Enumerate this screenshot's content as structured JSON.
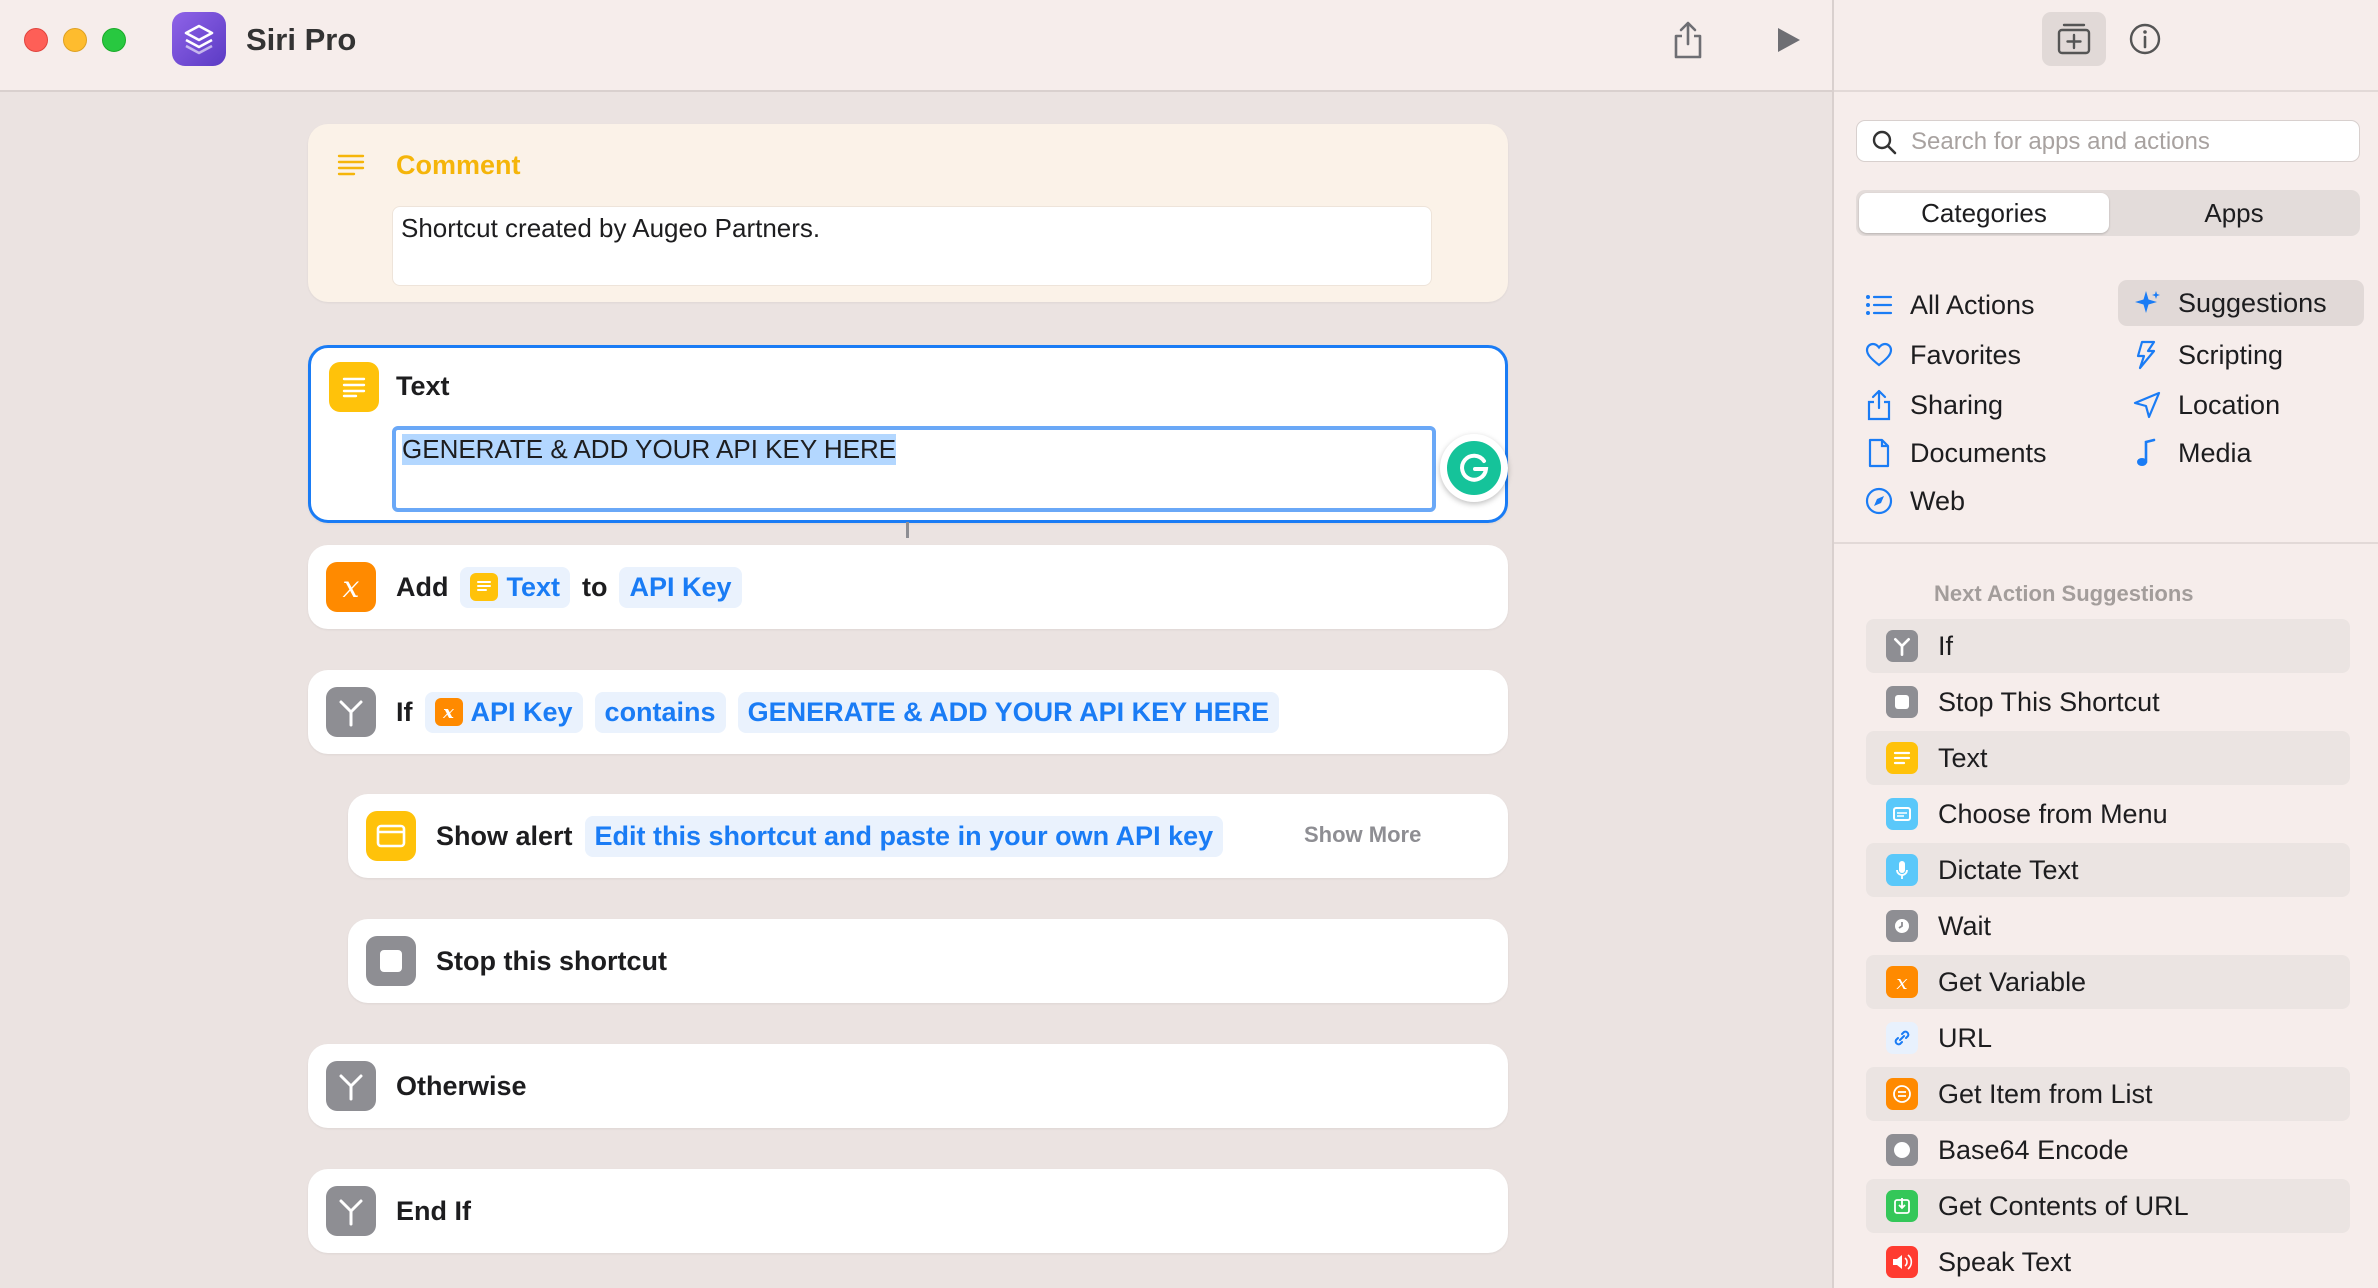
{
  "window": {
    "title": "Siri Pro"
  },
  "toolbar": {
    "share_icon": "share-icon",
    "run_icon": "play-icon"
  },
  "sidebar_toolbar": {
    "library_icon": "action-library-icon",
    "info_icon": "info-icon"
  },
  "editor": {
    "comment": {
      "label": "Comment",
      "body": "Shortcut created by Augeo Partners."
    },
    "text_action": {
      "label": "Text",
      "value": "GENERATE & ADD YOUR API KEY HERE"
    },
    "add_action": {
      "label": "Add",
      "input": "Text",
      "connector": "to",
      "variable": "API Key"
    },
    "if_action": {
      "label": "If",
      "variable": "API Key",
      "operator": "contains",
      "value": "GENERATE & ADD YOUR API KEY HERE"
    },
    "alert_action": {
      "label": "Show alert",
      "message": "Edit this shortcut and paste in your own API key",
      "show_more": "Show More"
    },
    "stop_action": {
      "label": "Stop this shortcut"
    },
    "otherwise_action": {
      "label": "Otherwise"
    },
    "endif_action": {
      "label": "End If"
    }
  },
  "sidebar": {
    "search_placeholder": "Search for apps and actions",
    "segments": [
      "Categories",
      "Apps"
    ],
    "categories": [
      {
        "label": "All Actions",
        "icon": "list-icon"
      },
      {
        "label": "Suggestions",
        "icon": "sparkle-icon",
        "selected": true
      },
      {
        "label": "Favorites",
        "icon": "heart-icon"
      },
      {
        "label": "Scripting",
        "icon": "scripting-icon"
      },
      {
        "label": "Sharing",
        "icon": "share-icon"
      },
      {
        "label": "Location",
        "icon": "location-arrow-icon"
      },
      {
        "label": "Documents",
        "icon": "document-icon"
      },
      {
        "label": "Media",
        "icon": "music-note-icon"
      },
      {
        "label": "Web",
        "icon": "compass-icon"
      }
    ],
    "next_title": "Next Action Suggestions",
    "suggestions": [
      {
        "label": "If",
        "color": "#8e8e93"
      },
      {
        "label": "Stop This Shortcut",
        "color": "#8e8e93"
      },
      {
        "label": "Text",
        "color": "#ffc20a"
      },
      {
        "label": "Choose from Menu",
        "color": "#5ac8fa"
      },
      {
        "label": "Dictate Text",
        "color": "#5ac8fa"
      },
      {
        "label": "Wait",
        "color": "#8e8e93"
      },
      {
        "label": "Get Variable",
        "color": "#ff8a00"
      },
      {
        "label": "URL",
        "color": "#1a7cf5"
      },
      {
        "label": "Get Item from List",
        "color": "#ff8a00"
      },
      {
        "label": "Base64 Encode",
        "color": "#8e8e93"
      },
      {
        "label": "Get Contents of URL",
        "color": "#34c759"
      },
      {
        "label": "Speak Text",
        "color": "#ff3b30"
      }
    ]
  },
  "colors": {
    "accent": "#1a7cf5",
    "comment_yellow": "#f5b50a",
    "variable_orange": "#ff8a00",
    "grammarly_green": "#15c39a"
  }
}
